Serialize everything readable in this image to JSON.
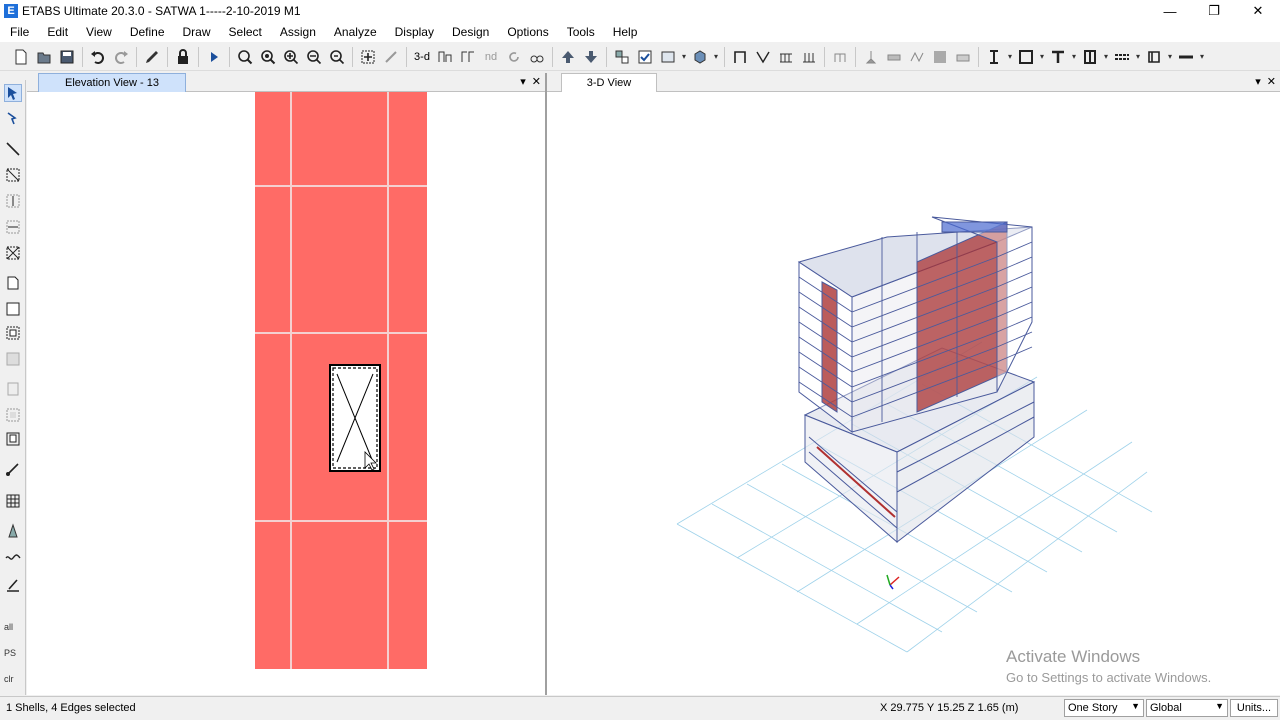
{
  "window": {
    "title": "ETABS Ultimate 20.3.0 - SATWA 1-----2-10-2019 M1",
    "app_icon_letter": "E",
    "controls": [
      "—",
      "❐",
      "✕"
    ]
  },
  "menu": [
    "File",
    "Edit",
    "View",
    "Define",
    "Draw",
    "Select",
    "Assign",
    "Analyze",
    "Display",
    "Design",
    "Options",
    "Tools",
    "Help"
  ],
  "toolbar": {
    "icons": [
      "new-model-icon",
      "open-icon",
      "save-icon",
      "undo-icon",
      "redo-icon",
      "pen-icon",
      "lock-icon",
      "run-analysis-icon",
      "zoom-window-icon",
      "zoom-fit-icon",
      "zoom-in-icon",
      "zoom-out-icon",
      "zoom-minus-icon",
      "pan-icon",
      "pointer-icon",
      "view-3d-icon",
      "view-plan-icon",
      "view-elevation-icon",
      "view-nd-icon",
      "rotate-icon",
      "perspective-icon",
      "move-up-icon",
      "move-down-icon",
      "object-shrink-icon",
      "set-display-icon",
      "assign-icon",
      "extrude-icon",
      "frame-icon",
      "brace-icon",
      "beam-icon",
      "column-icon",
      "link-icon",
      "support-icon",
      "wall-icon",
      "slab-icon",
      "opening-icon",
      "deck-icon",
      "section-i-icon",
      "box-icon",
      "t-section-icon",
      "i-section-icon",
      "rebar-icon",
      "dimension-icon",
      "line-style-icon"
    ],
    "labels": {
      "view_3d": "3-d",
      "view_nd": "nd"
    }
  },
  "left_tools": {
    "labels": {
      "all": "all",
      "ps": "PS",
      "clr": "clr"
    }
  },
  "panels": {
    "elevation": {
      "tab_label": "Elevation View - 13"
    },
    "view3d": {
      "tab_label": "3-D View"
    }
  },
  "watermark": {
    "line1": "Activate Windows",
    "line2": "Go to Settings to activate Windows."
  },
  "status": {
    "selection": "1 Shells, 4 Edges selected",
    "coords": "X 29.775  Y 15.25  Z 1.65 (m)",
    "story_select": "One Story",
    "coord_system_select": "Global",
    "units_button": "Units..."
  },
  "colors": {
    "shell": "#ff6b66",
    "accent_tab": "#cfe2fb"
  }
}
